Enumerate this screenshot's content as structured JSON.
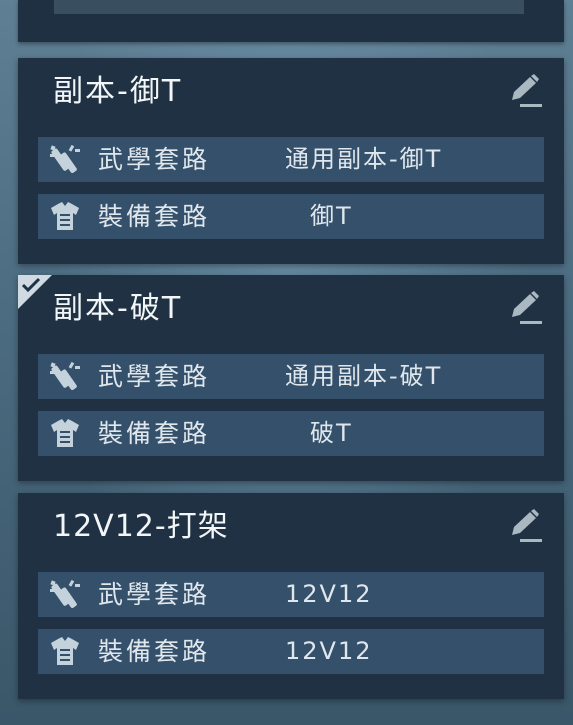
{
  "cards": [
    {
      "title": "副本-御T",
      "selected": false,
      "rows": [
        {
          "icon": "martial-arts-icon",
          "label": "武學套路",
          "value": "通用副本-御T"
        },
        {
          "icon": "armor-icon",
          "label": "裝備套路",
          "value": "御T"
        }
      ]
    },
    {
      "title": "副本-破T",
      "selected": true,
      "rows": [
        {
          "icon": "martial-arts-icon",
          "label": "武學套路",
          "value": "通用副本-破T"
        },
        {
          "icon": "armor-icon",
          "label": "裝備套路",
          "value": "破T"
        }
      ]
    },
    {
      "title": "12V12-打架",
      "selected": false,
      "rows": [
        {
          "icon": "martial-arts-icon",
          "label": "武學套路",
          "value": "12V12"
        },
        {
          "icon": "armor-icon",
          "label": "裝備套路",
          "value": "12V12"
        }
      ]
    }
  ],
  "icons": {
    "edit": "pencil-edit-icon",
    "check": "checkmark-icon"
  },
  "colors": {
    "card_bg": "#1f3142",
    "row_bg": "#35506a",
    "text": "#dfe7ed",
    "icon": "#9fb4c3"
  }
}
